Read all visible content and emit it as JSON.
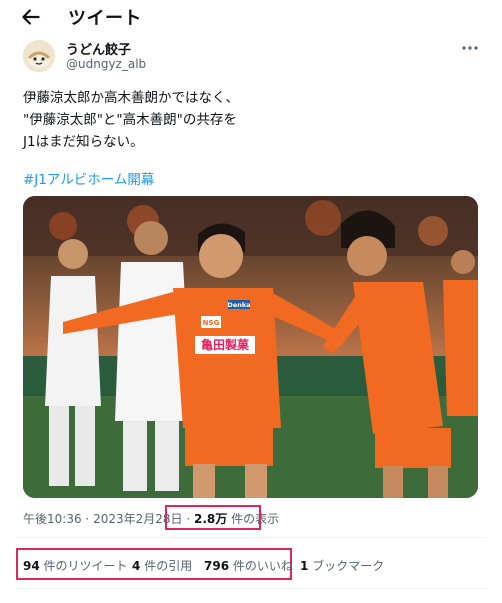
{
  "header": {
    "title": "ツイート"
  },
  "author": {
    "name": "うどん餃子",
    "handle": "@udngyz_alb"
  },
  "tweet": {
    "lines": [
      "伊藤涼太郎か高木善朗かではなく、",
      "\"伊藤涼太郎\"と\"高木善朗\"の共存を",
      "J1はまだ知らない。"
    ],
    "hashtag": "#J1アルビホーム開幕"
  },
  "media": {
    "sponsor_chest": "亀田製菓",
    "sponsor_sleeve": "NSG",
    "sponsor_shoulder": "Denka",
    "colors": {
      "orange": "#f26a21",
      "white_kit": "#f3f3f3"
    }
  },
  "meta": {
    "time": "午後10:36",
    "sep": "·",
    "date": "2023年2月28日",
    "views_count": "2.8万",
    "views_label": "件の表示"
  },
  "stats": {
    "retweets_count": "94",
    "retweets_label": "件のリツイート",
    "quotes_count": "4",
    "quotes_label": "件の引用",
    "likes_count": "796",
    "likes_label": "件のいいね",
    "bookmarks_count": "1",
    "bookmarks_label": "ブックマーク"
  },
  "colors": {
    "link": "#1d9bf0",
    "highlight": "#e0245e",
    "muted": "#536471"
  },
  "icons": {
    "back": "arrow-left-icon",
    "more": "more-dots-icon"
  }
}
